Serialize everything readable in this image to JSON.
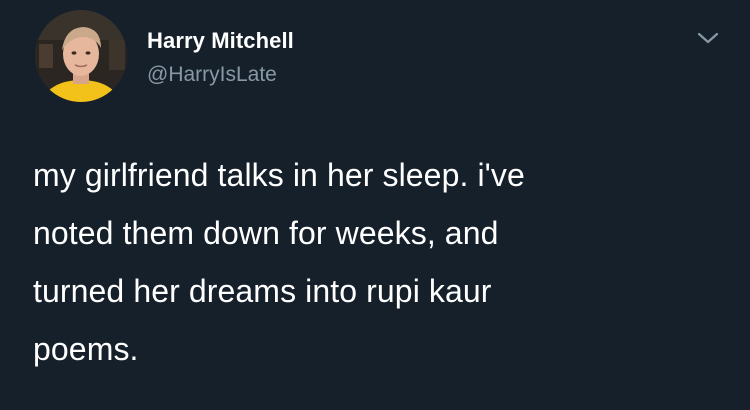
{
  "author": {
    "display_name": "Harry Mitchell",
    "handle": "@HarryIsLate"
  },
  "tweet": {
    "text": "my girlfriend talks in her sleep. i've\nnoted them down for weeks, and\nturned her dreams into rupi kaur\npoems."
  },
  "icons": {
    "more": "chevron-down-icon"
  },
  "colors": {
    "background": "#15202b",
    "primary_text": "#ffffff",
    "secondary_text": "#8899a6"
  }
}
